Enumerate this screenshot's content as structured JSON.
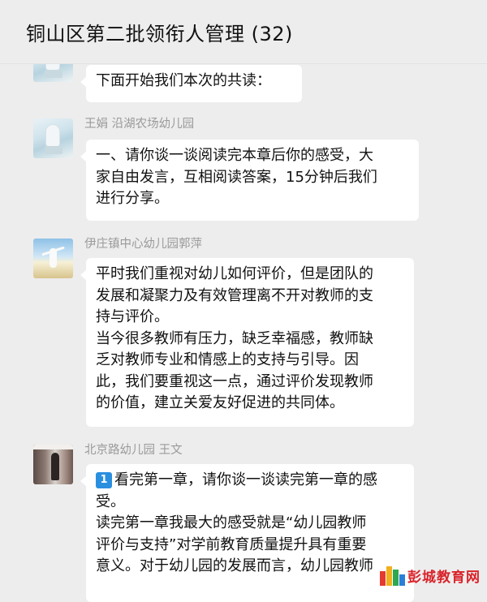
{
  "header": {
    "title": "铜山区第二批领衔人管理 (32)"
  },
  "messages": [
    {
      "sender": "",
      "lines": [
        "下面开始我们本次的共读："
      ]
    },
    {
      "sender": "王娟 沿湖农场幼儿园",
      "lines": [
        "一、请你谈一谈阅读完本章后你的感受，大",
        "家自由发言，互相阅读答案，15分钟后我们",
        "进行分享。"
      ]
    },
    {
      "sender": "伊庄镇中心幼儿园郭萍",
      "lines": [
        "平时我们重视对幼儿如何评价，但是团队的",
        "发展和凝聚力及有效管理离不开对教师的支",
        "持与评价。",
        "当今很多教师有压力，缺乏幸福感，教师缺",
        "乏对教师专业和情感上的支持与引导。因",
        "此，我们要重视这一点，通过评价发现教师",
        "的价值，建立关爱友好促进的共同体。"
      ]
    },
    {
      "sender": "北京路幼儿园 王文",
      "badge": "1",
      "lines": [
        "看完第一章，请你谈一谈读完第一章的感",
        "受。",
        "读完第一章我最大的感受就是“幼儿园教师",
        "评价与支持”对学前教育质量提升具有重要",
        "意义。对于幼儿园的发展而言，幼儿园教师"
      ]
    }
  ],
  "watermark": {
    "text": "彭城教育网"
  }
}
